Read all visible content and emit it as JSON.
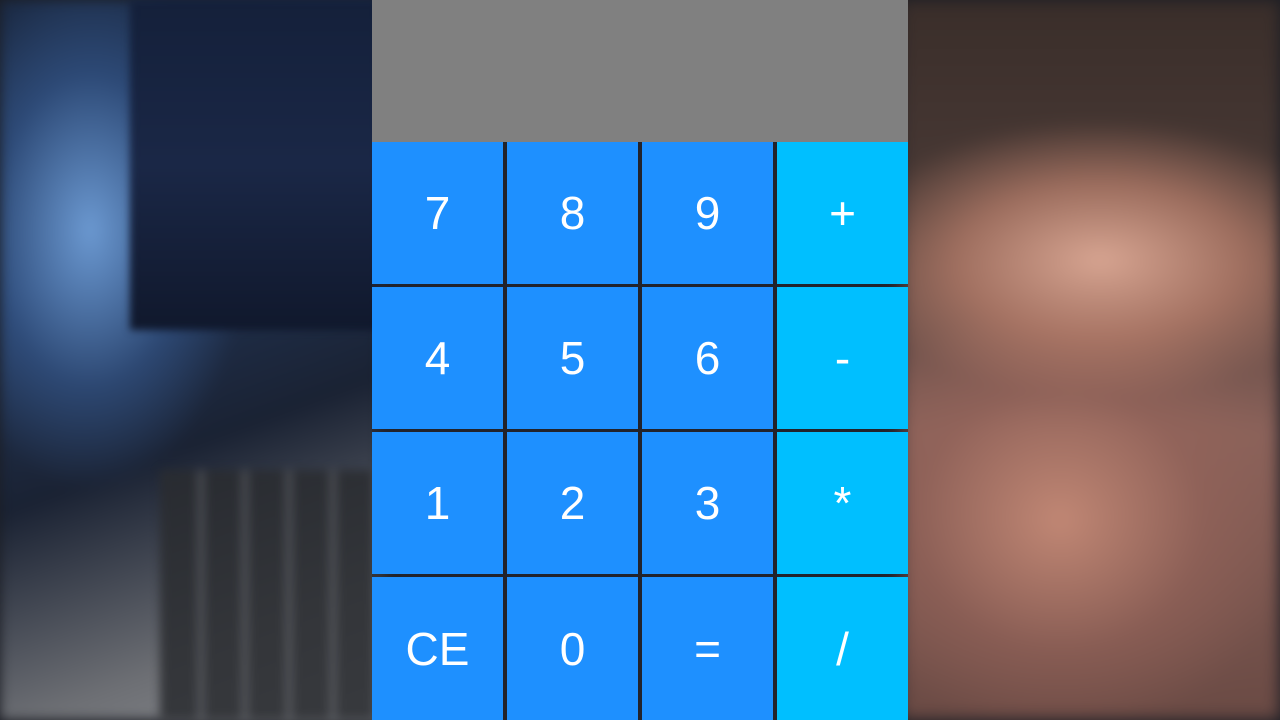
{
  "display": {
    "value": ""
  },
  "keypad": {
    "rows": [
      [
        {
          "label": "7",
          "type": "digit"
        },
        {
          "label": "8",
          "type": "digit"
        },
        {
          "label": "9",
          "type": "digit"
        },
        {
          "label": "+",
          "type": "operator"
        }
      ],
      [
        {
          "label": "4",
          "type": "digit"
        },
        {
          "label": "5",
          "type": "digit"
        },
        {
          "label": "6",
          "type": "digit"
        },
        {
          "label": "-",
          "type": "operator"
        }
      ],
      [
        {
          "label": "1",
          "type": "digit"
        },
        {
          "label": "2",
          "type": "digit"
        },
        {
          "label": "3",
          "type": "digit"
        },
        {
          "label": "*",
          "type": "operator"
        }
      ],
      [
        {
          "label": "CE",
          "type": "clear"
        },
        {
          "label": "0",
          "type": "digit"
        },
        {
          "label": "=",
          "type": "equals"
        },
        {
          "label": "/",
          "type": "operator"
        }
      ]
    ]
  },
  "colors": {
    "display_bg": "#808080",
    "key_bg": "#1e90ff",
    "operator_bg": "#00bfff",
    "text": "#ffffff"
  }
}
